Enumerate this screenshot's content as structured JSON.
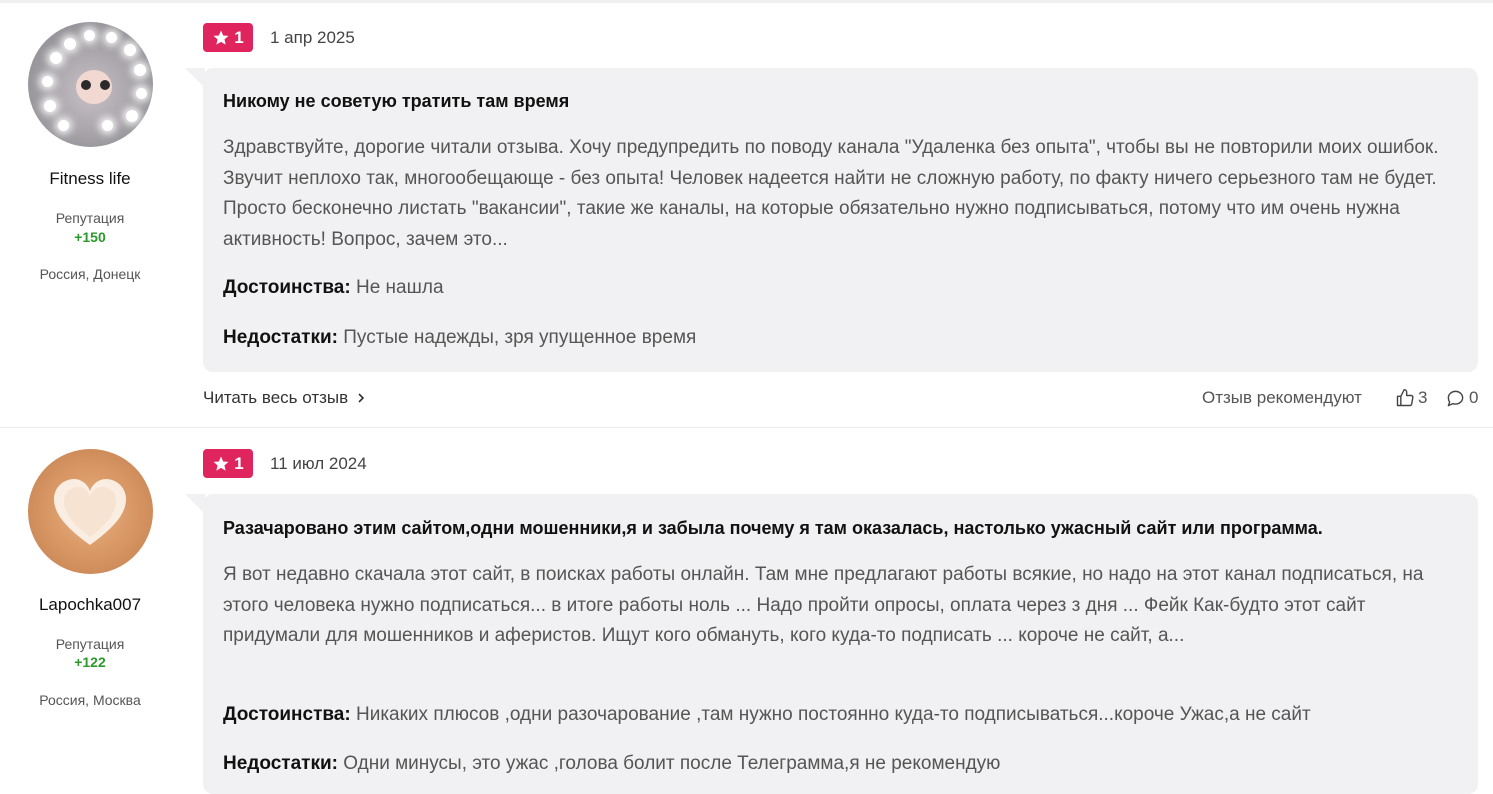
{
  "reviews": [
    {
      "author": {
        "name": "Fitness life",
        "reputation_label": "Репутация",
        "reputation_value": "+150",
        "location": "Россия, Донецк"
      },
      "rating": "1",
      "date": "1 апр 2025",
      "title": "Никому не советую тратить там время",
      "body": "Здравствуйте, дорогие читали отзыва. Хочу предупредить по поводу канала \"Удаленка без опыта\", чтобы вы не повторили моих ошибок. Звучит неплохо так, многообещающе - без опыта! Человек надеется найти не сложную работу, по факту ничего серьезного там не будет. Просто бесконечно листать \"вакансии\", такие же каналы, на которые обязательно нужно подписываться, потому что им очень нужна активность! Вопрос, зачем это...",
      "pros_label": "Достоинства:",
      "pros": "Не нашла",
      "cons_label": "Недостатки:",
      "cons": "Пустые надежды, зря упущенное время",
      "read_more": "Читать весь отзыв",
      "recommend_label": "Отзыв рекомендуют",
      "likes": "3",
      "comments": "0"
    },
    {
      "author": {
        "name": "Lapochka007",
        "reputation_label": "Репутация",
        "reputation_value": "+122",
        "location": "Россия, Москва"
      },
      "rating": "1",
      "date": "11 июл 2024",
      "title": "Разачаровано этим сайтом,одни мошенники,я и забыла почему я там оказалась, настолько ужасный сайт или программа.",
      "body": "Я вот недавно скачала этот сайт, в поисках работы онлайн. Там мне предлагают работы всякие, но надо на этот канал подписаться, на этого человека нужно подписаться... в итоге работы ноль ... Надо пройти опросы, оплата через з дня ... Фейк Как-будто этот сайт придумали для мошенников и аферистов. Ищут кого обмануть, кого куда-то подписать ... короче не сайт, а...",
      "pros_label": "Достоинства:",
      "pros": "Никаких плюсов ,одни разочарование ,там нужно постоянно куда-то подписываться...короче Ужас,а не сайт",
      "cons_label": "Недостатки:",
      "cons": "Одни минусы, это ужас ,голова болит после Телеграмма,я не рекомендую"
    }
  ],
  "colors": {
    "badge": "#e0245e",
    "reputation": "#2b9a2b",
    "bubble": "#f1f1f3"
  },
  "icons": [
    "star-icon",
    "chevron-right-icon",
    "thumbs-up-icon",
    "comment-icon"
  ]
}
